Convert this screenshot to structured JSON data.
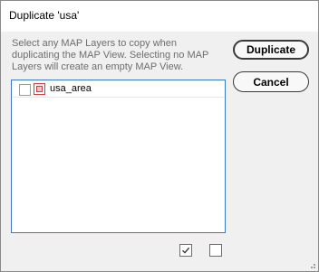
{
  "dialog": {
    "title": "Duplicate 'usa'",
    "description": "Select any MAP Layers to copy when duplicating the MAP View. Selecting no MAP Layers will create an empty MAP View."
  },
  "layers": [
    {
      "name": "usa_area",
      "checked": false,
      "icon": "polygon-layer-icon"
    }
  ],
  "buttons": {
    "duplicate_label": "Duplicate",
    "cancel_label": "Cancel"
  },
  "footer": {
    "check_all_icon": "check-all-icon",
    "uncheck_all_icon": "uncheck-all-icon"
  },
  "colors": {
    "accent_border": "#3c78c8",
    "layer_icon": "#d63a3a"
  }
}
